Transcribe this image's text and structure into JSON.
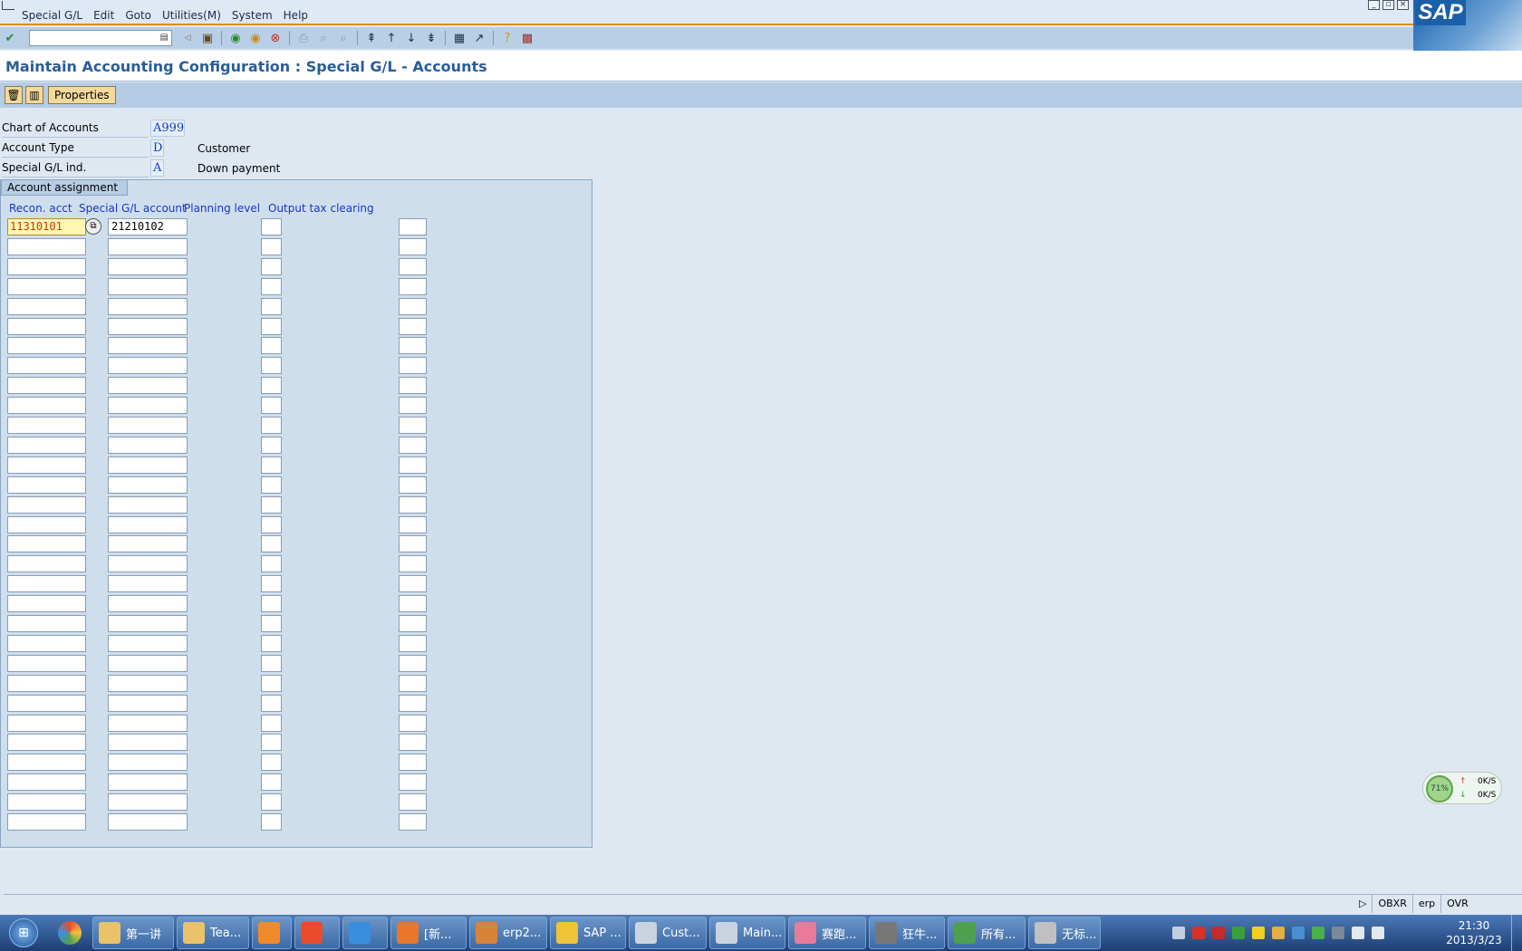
{
  "menubar": {
    "items": [
      "Special G/L",
      "Edit",
      "Goto",
      "Utilities(M)",
      "System",
      "Help"
    ],
    "logo": "SAP"
  },
  "toolbar": {
    "command_field_value": "",
    "icons": [
      "enter-icon",
      "back-icon",
      "save-icon",
      "exit-icon",
      "cancel-icon",
      "print-icon",
      "find-icon",
      "find-next-icon",
      "first-page-icon",
      "previous-page-icon",
      "next-page-icon",
      "last-page-icon",
      "create-session-icon",
      "shortcut-icon",
      "help-icon",
      "layout-icon"
    ]
  },
  "page": {
    "title": "Maintain Accounting Configuration : Special G/L - Accounts"
  },
  "app_toolbar": {
    "properties_label": "Properties"
  },
  "header": {
    "chart_label": "Chart of Accounts",
    "chart_value": "A999",
    "account_type_label": "Account Type",
    "account_type_value": "D",
    "account_type_desc": "Customer",
    "special_gl_label": "Special G/L ind.",
    "special_gl_value": "A",
    "special_gl_desc": "Down payment"
  },
  "assignment": {
    "group_title": "Account assignment",
    "columns": {
      "recon": "Recon. acct",
      "special_gl": "Special G/L account",
      "planning": "Planning level",
      "output_tax": "Output tax clearing"
    },
    "rows": [
      {
        "recon": "11310101",
        "special_gl": "21210102",
        "planning": "",
        "output_tax": ""
      },
      {
        "recon": "",
        "special_gl": "",
        "planning": "",
        "output_tax": ""
      },
      {
        "recon": "",
        "special_gl": "",
        "planning": "",
        "output_tax": ""
      },
      {
        "recon": "",
        "special_gl": "",
        "planning": "",
        "output_tax": ""
      },
      {
        "recon": "",
        "special_gl": "",
        "planning": "",
        "output_tax": ""
      },
      {
        "recon": "",
        "special_gl": "",
        "planning": "",
        "output_tax": ""
      },
      {
        "recon": "",
        "special_gl": "",
        "planning": "",
        "output_tax": ""
      },
      {
        "recon": "",
        "special_gl": "",
        "planning": "",
        "output_tax": ""
      },
      {
        "recon": "",
        "special_gl": "",
        "planning": "",
        "output_tax": ""
      },
      {
        "recon": "",
        "special_gl": "",
        "planning": "",
        "output_tax": ""
      },
      {
        "recon": "",
        "special_gl": "",
        "planning": "",
        "output_tax": ""
      },
      {
        "recon": "",
        "special_gl": "",
        "planning": "",
        "output_tax": ""
      },
      {
        "recon": "",
        "special_gl": "",
        "planning": "",
        "output_tax": ""
      },
      {
        "recon": "",
        "special_gl": "",
        "planning": "",
        "output_tax": ""
      },
      {
        "recon": "",
        "special_gl": "",
        "planning": "",
        "output_tax": ""
      },
      {
        "recon": "",
        "special_gl": "",
        "planning": "",
        "output_tax": ""
      },
      {
        "recon": "",
        "special_gl": "",
        "planning": "",
        "output_tax": ""
      },
      {
        "recon": "",
        "special_gl": "",
        "planning": "",
        "output_tax": ""
      },
      {
        "recon": "",
        "special_gl": "",
        "planning": "",
        "output_tax": ""
      },
      {
        "recon": "",
        "special_gl": "",
        "planning": "",
        "output_tax": ""
      },
      {
        "recon": "",
        "special_gl": "",
        "planning": "",
        "output_tax": ""
      },
      {
        "recon": "",
        "special_gl": "",
        "planning": "",
        "output_tax": ""
      },
      {
        "recon": "",
        "special_gl": "",
        "planning": "",
        "output_tax": ""
      },
      {
        "recon": "",
        "special_gl": "",
        "planning": "",
        "output_tax": ""
      },
      {
        "recon": "",
        "special_gl": "",
        "planning": "",
        "output_tax": ""
      },
      {
        "recon": "",
        "special_gl": "",
        "planning": "",
        "output_tax": ""
      },
      {
        "recon": "",
        "special_gl": "",
        "planning": "",
        "output_tax": ""
      },
      {
        "recon": "",
        "special_gl": "",
        "planning": "",
        "output_tax": ""
      },
      {
        "recon": "",
        "special_gl": "",
        "planning": "",
        "output_tax": ""
      },
      {
        "recon": "",
        "special_gl": "",
        "planning": "",
        "output_tax": ""
      },
      {
        "recon": "",
        "special_gl": "",
        "planning": "",
        "output_tax": ""
      }
    ]
  },
  "statusbar": {
    "transaction": "OBXR",
    "system": "erp",
    "mode": "OVR"
  },
  "netmonitor": {
    "percent": "71%",
    "upload": "0K/S",
    "download": "0K/S"
  },
  "taskbar": {
    "tasks": [
      {
        "label": "第一讲",
        "color": "#e9c26a"
      },
      {
        "label": "Tea...",
        "color": "#e9c26a"
      },
      {
        "label": "",
        "color": "#f08a2a"
      },
      {
        "label": "",
        "color": "#e84c2b"
      },
      {
        "label": "",
        "color": "#3a8ee0"
      },
      {
        "label": "[新...",
        "color": "#e8772b"
      },
      {
        "label": "erp2...",
        "color": "#d9823a"
      },
      {
        "label": "SAP ...",
        "color": "#f0c23a"
      },
      {
        "label": "Cust...",
        "color": "#c9d4e0"
      },
      {
        "label": "Main...",
        "color": "#c9d4e0"
      },
      {
        "label": "赛跑...",
        "color": "#e87a9a"
      },
      {
        "label": "狂牛...",
        "color": "#777777"
      },
      {
        "label": "所有...",
        "color": "#4ea04e"
      },
      {
        "label": "无标...",
        "color": "#c0c0c0"
      }
    ],
    "time": "21:30",
    "date": "2013/3/23"
  }
}
